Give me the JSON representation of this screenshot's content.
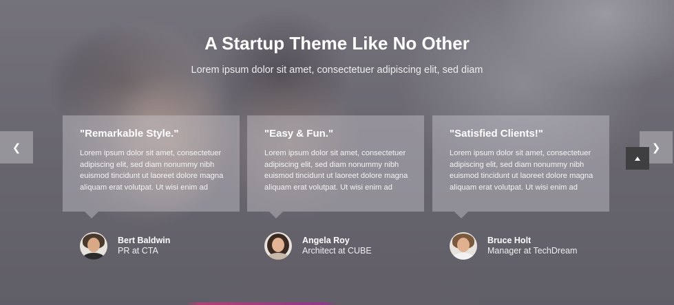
{
  "section": {
    "title": "A Startup Theme Like No Other",
    "subtitle": "Lorem ipsum dolor sit amet, consectetuer adipiscing elit, sed diam"
  },
  "testimonials": [
    {
      "quote_title": "\"Remarkable Style.\"",
      "text": "Lorem ipsum dolor sit amet, consectetuer adipiscing elit, sed diam nonummy nibh euismod tincidunt ut laoreet dolore magna aliquam erat volutpat. Ut wisi enim ad",
      "name": "Bert Baldwin",
      "role": "PR at CTA"
    },
    {
      "quote_title": "\"Easy & Fun.\"",
      "text": "Lorem ipsum dolor sit amet, consectetuer adipiscing elit, sed diam nonummy nibh euismod tincidunt ut laoreet dolore magna aliquam erat volutpat. Ut wisi enim ad",
      "name": "Angela Roy",
      "role": "Architect at CUBE"
    },
    {
      "quote_title": "\"Satisfied Clients!\"",
      "text": "Lorem ipsum dolor sit amet, consectetuer adipiscing elit, sed diam nonummy nibh euismod tincidunt ut laoreet dolore magna aliquam erat volutpat. Ut wisi enim ad",
      "name": "Bruce Holt",
      "role": "Manager at TechDream"
    }
  ],
  "controls": {
    "prev_icon": "chevron-left-icon",
    "prev_glyph": "❮",
    "next_icon": "chevron-right-icon",
    "next_glyph": "❯",
    "scroll_top_icon": "caret-up-icon"
  },
  "colors": {
    "card_background": "#cdcbd2",
    "scroll_top_button": "#3f3f42",
    "accent_strip": "#c23b7a"
  }
}
